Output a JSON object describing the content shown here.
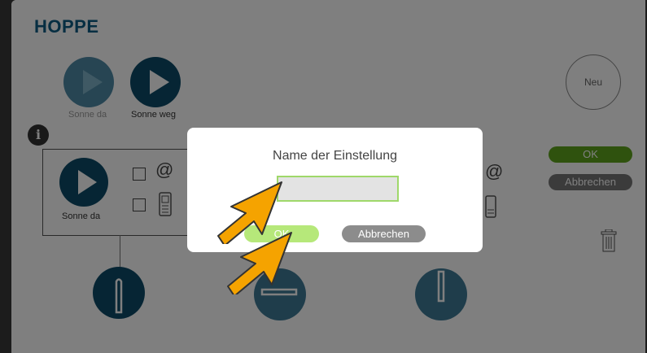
{
  "app": {
    "brand": "HOPPE",
    "scene_buttons": [
      {
        "label": "Sonne da"
      },
      {
        "label": "Sonne weg"
      }
    ],
    "info_icon": "i",
    "card": {
      "label": "Sonne da",
      "email_symbol": "@"
    },
    "right_email_symbol": "@",
    "new_button": "Neu",
    "ok_button": "OK",
    "cancel_button": "Abbrechen"
  },
  "dialog": {
    "title": "Name der Einstellung",
    "input_value": "",
    "ok_label": "OK",
    "cancel_label": "Abbrechen"
  },
  "colors": {
    "brand": "#0d5c84",
    "play_dark": "#0d4b68",
    "ok_green": "#5ea51d",
    "dialog_ok": "#b6e87a",
    "pointer_arrow": "#f5a300"
  }
}
